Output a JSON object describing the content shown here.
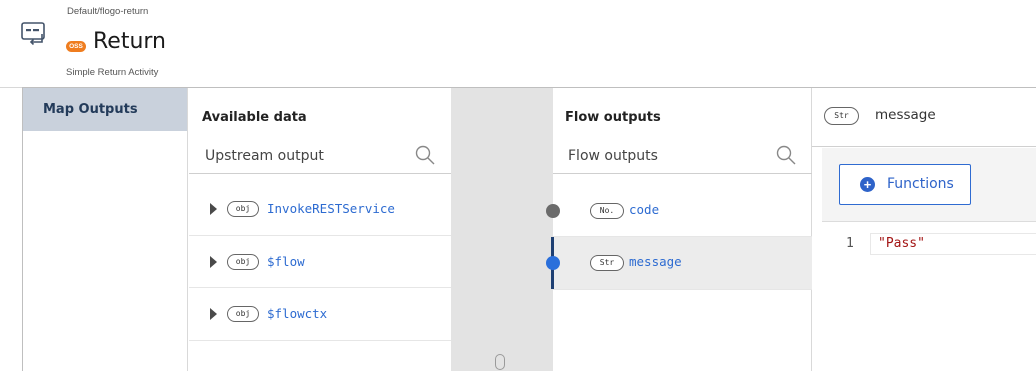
{
  "header": {
    "path": "Default/flogo-return",
    "badge": "OSS",
    "title": "Return",
    "subtitle": "Simple Return Activity"
  },
  "tabs": [
    {
      "label": "Map Outputs",
      "active": true
    }
  ],
  "available": {
    "title": "Available data",
    "search_placeholder": "Upstream output",
    "items": [
      {
        "type": "obj",
        "name": "InvokeRESTService"
      },
      {
        "type": "obj",
        "name": "$flow"
      },
      {
        "type": "obj",
        "name": "$flowctx"
      }
    ]
  },
  "flow_outputs": {
    "title": "Flow outputs",
    "search_placeholder": "Flow outputs",
    "items": [
      {
        "type": "No.",
        "name": "code",
        "mapped": false
      },
      {
        "type": "Str",
        "name": "message",
        "mapped": true
      }
    ]
  },
  "editor": {
    "type": "Str",
    "name": "message",
    "functions_label": "Functions",
    "lines": [
      {
        "number": "1",
        "code": "\"Pass\""
      }
    ]
  },
  "colors": {
    "accent": "#2e63c9",
    "tab_active_bg": "#c9d1dc",
    "oss_badge": "#ef7d1f",
    "string_literal": "#a31515"
  }
}
